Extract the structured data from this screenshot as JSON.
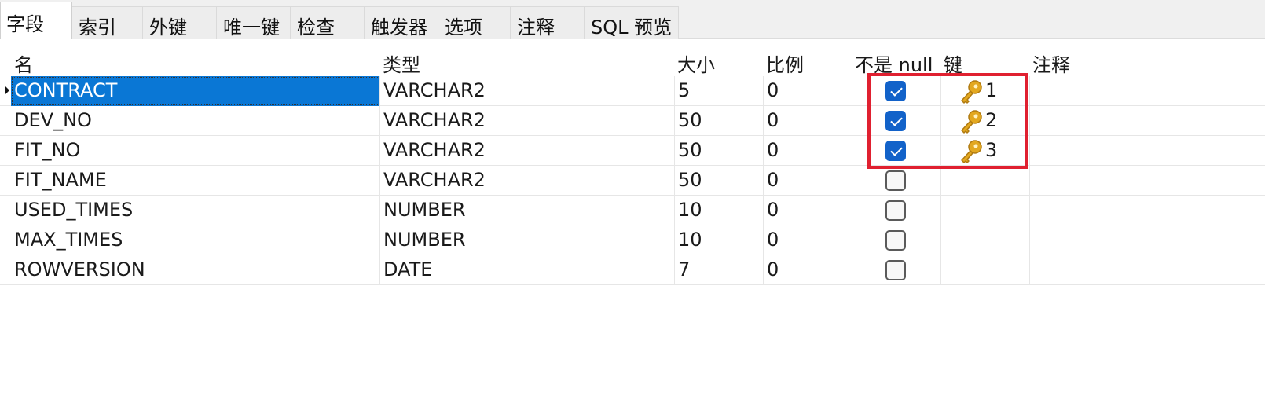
{
  "tabs": [
    {
      "label": "字段",
      "active": true
    },
    {
      "label": "索引",
      "active": false
    },
    {
      "label": "外键",
      "active": false
    },
    {
      "label": "唯一键",
      "active": false
    },
    {
      "label": "检查",
      "active": false
    },
    {
      "label": "触发器",
      "active": false
    },
    {
      "label": "选项",
      "active": false
    },
    {
      "label": "注释",
      "active": false
    },
    {
      "label": "SQL 预览",
      "active": false
    }
  ],
  "columns": [
    "名",
    "类型",
    "大小",
    "比例",
    "不是 null",
    "键",
    "注释"
  ],
  "rows": [
    {
      "name": "CONTRACT",
      "type": "VARCHAR2",
      "size": "5",
      "scale": "0",
      "not_null": true,
      "key": "1",
      "comment": "",
      "selected": true
    },
    {
      "name": "DEV_NO",
      "type": "VARCHAR2",
      "size": "50",
      "scale": "0",
      "not_null": true,
      "key": "2",
      "comment": ""
    },
    {
      "name": "FIT_NO",
      "type": "VARCHAR2",
      "size": "50",
      "scale": "0",
      "not_null": true,
      "key": "3",
      "comment": ""
    },
    {
      "name": "FIT_NAME",
      "type": "VARCHAR2",
      "size": "50",
      "scale": "0",
      "not_null": false,
      "key": "",
      "comment": ""
    },
    {
      "name": "USED_TIMES",
      "type": "NUMBER",
      "size": "10",
      "scale": "0",
      "not_null": false,
      "key": "",
      "comment": ""
    },
    {
      "name": "MAX_TIMES",
      "type": "NUMBER",
      "size": "10",
      "scale": "0",
      "not_null": false,
      "key": "",
      "comment": ""
    },
    {
      "name": "ROWVERSION",
      "type": "DATE",
      "size": "7",
      "scale": "0",
      "not_null": false,
      "key": "",
      "comment": ""
    }
  ],
  "icons": {
    "key": "key-icon",
    "row_marker": "row-indicator-icon"
  },
  "colors": {
    "selection": "#0a77d5",
    "checkbox_on": "#1262c9",
    "key_gold": "#e3a820",
    "highlight_box": "#e02030"
  }
}
